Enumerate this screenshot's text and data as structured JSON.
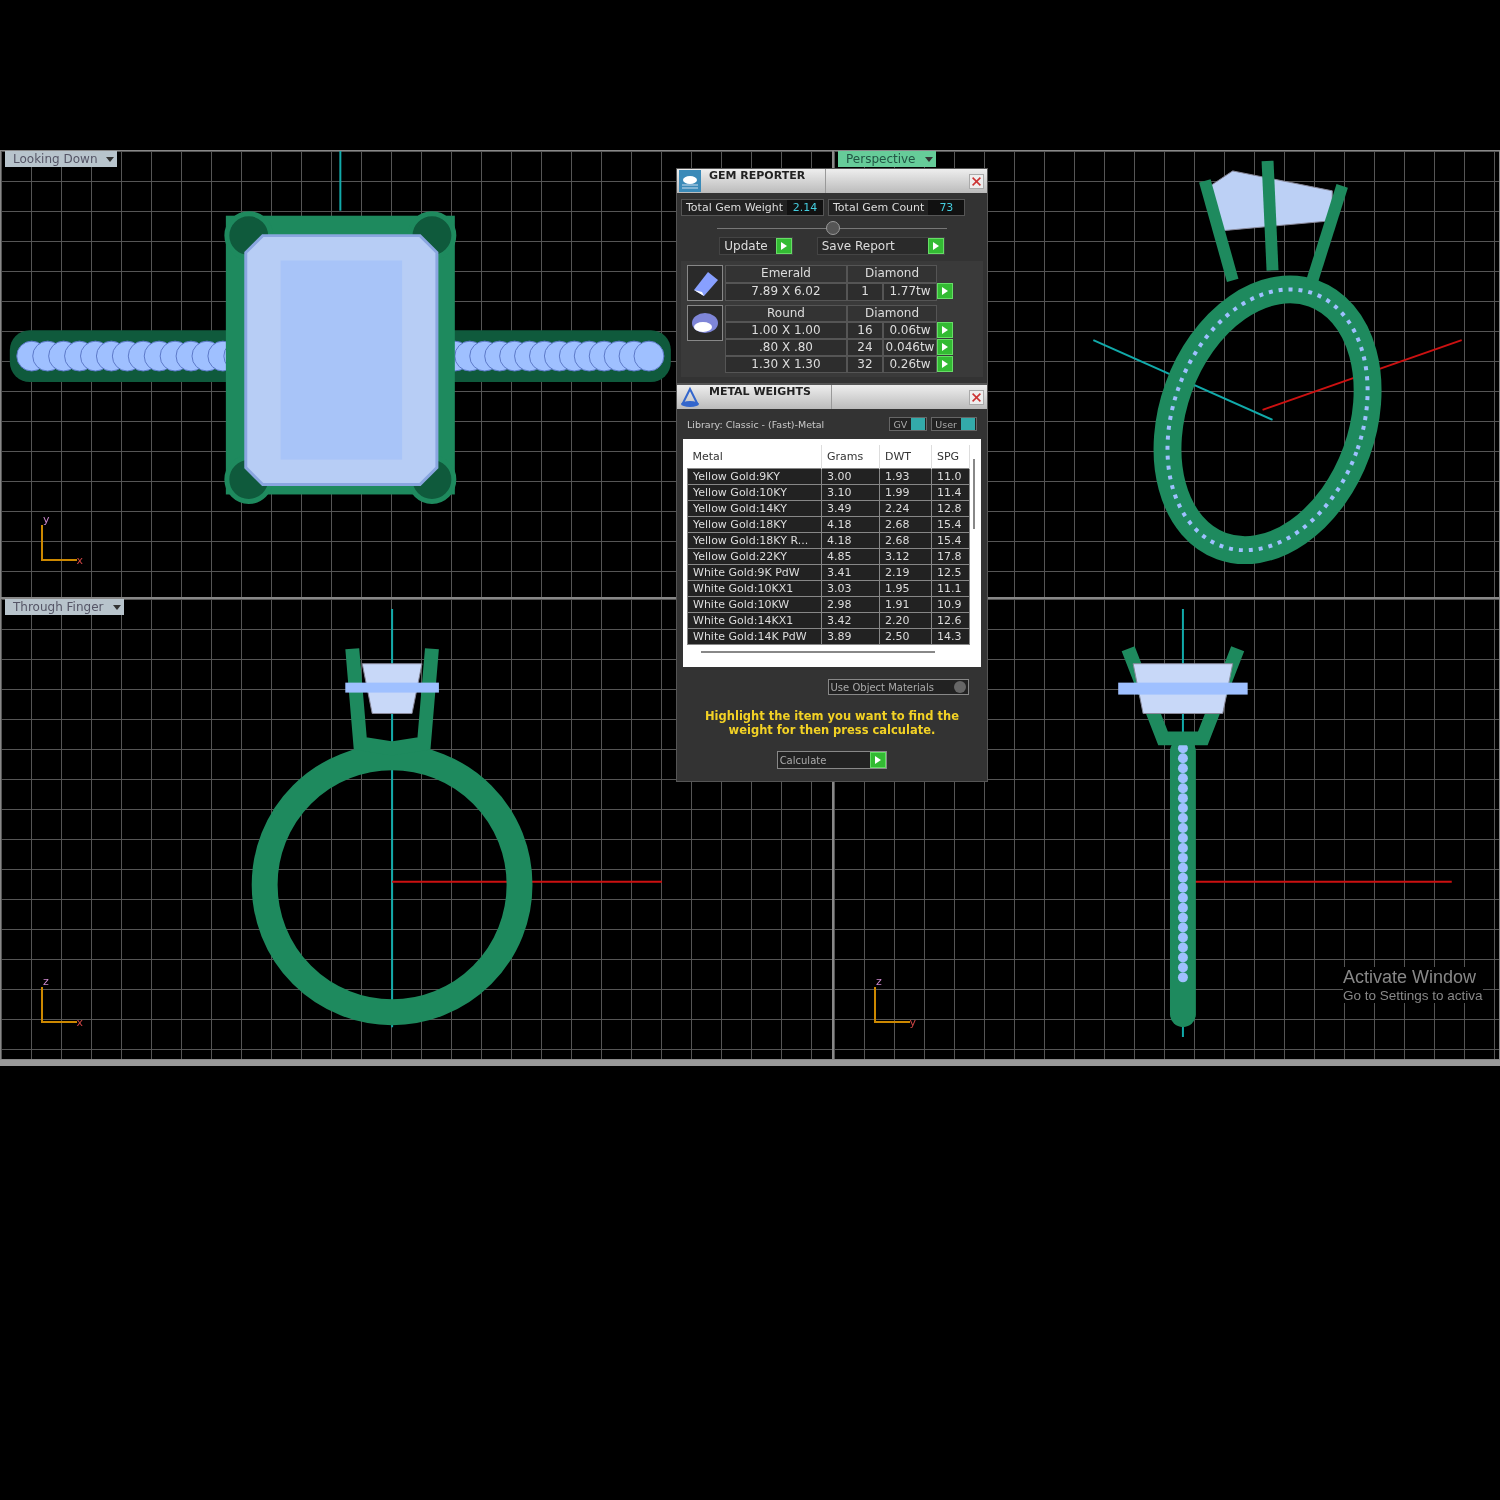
{
  "viewports": [
    {
      "label": "Looking Down",
      "kind": "top",
      "axes": [
        "y",
        "x"
      ]
    },
    {
      "label": "Perspective",
      "kind": "perspective"
    },
    {
      "label": "Through Finger",
      "kind": "front",
      "axes": [
        "z",
        "x"
      ]
    },
    {
      "kind": "side",
      "axes": [
        "z",
        "y"
      ]
    }
  ],
  "gem_reporter": {
    "title": "GEM REPORTER",
    "total_weight": {
      "label": "Total Gem Weight",
      "value": "2.14"
    },
    "total_count": {
      "label": "Total Gem Count",
      "value": "73"
    },
    "buttons": [
      "Update",
      "Save Report"
    ],
    "groups": [
      {
        "kind": "emerald",
        "shape": "Emerald",
        "material": "Diamond",
        "rows": [
          {
            "size": "7.89 X 6.02",
            "count": "1",
            "weight": "1.77tw"
          }
        ]
      },
      {
        "kind": "round",
        "shape": "Round",
        "material": "Diamond",
        "rows": [
          {
            "size": "1.00 X 1.00",
            "count": "16",
            "weight": "0.06tw"
          },
          {
            "size": ".80 X .80",
            "count": "24",
            "weight": "0.046tw"
          },
          {
            "size": "1.30 X 1.30",
            "count": "32",
            "weight": "0.26tw"
          }
        ]
      }
    ]
  },
  "metal_weights": {
    "title": "METAL WEIGHTS",
    "library": "Library: Classic - (Fast)-Metal",
    "toggles": [
      "GV",
      "User"
    ],
    "columns": [
      "Metal",
      "Grams",
      "DWT",
      "SPG"
    ],
    "rows": [
      [
        "Yellow Gold:9KY",
        "3.00",
        "1.93",
        "11.0"
      ],
      [
        "Yellow Gold:10KY",
        "3.10",
        "1.99",
        "11.4"
      ],
      [
        "Yellow Gold:14KY",
        "3.49",
        "2.24",
        "12.8"
      ],
      [
        "Yellow Gold:18KY",
        "4.18",
        "2.68",
        "15.4"
      ],
      [
        "Yellow Gold:18KY R...",
        "4.18",
        "2.68",
        "15.4"
      ],
      [
        "Yellow Gold:22KY",
        "4.85",
        "3.12",
        "17.8"
      ],
      [
        "White Gold:9K PdW",
        "3.41",
        "2.19",
        "12.5"
      ],
      [
        "White Gold:10KX1",
        "3.03",
        "1.95",
        "11.1"
      ],
      [
        "White Gold:10KW",
        "2.98",
        "1.91",
        "10.9"
      ],
      [
        "White Gold:14KX1",
        "3.42",
        "2.20",
        "12.6"
      ],
      [
        "White Gold:14K PdW",
        "3.89",
        "2.50",
        "14.3"
      ]
    ],
    "use_object_materials": "Use Object Materials",
    "hint": "Highlight the item you want to find the weight for then press calculate.",
    "calculate": "Calculate"
  },
  "os_notice": {
    "title": "Activate Window",
    "subtitle": "Go to Settings to activa"
  }
}
